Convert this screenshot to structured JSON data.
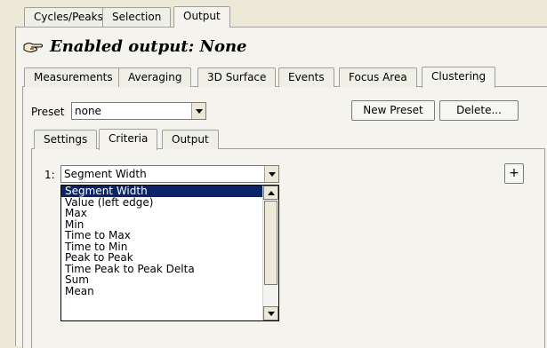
{
  "top_tabs": [
    "Cycles/Peaks",
    "Selection",
    "Output"
  ],
  "header": {
    "title": "Enabled output: None",
    "icon": "hand-pointer-icon"
  },
  "output_tabs": [
    "Measurements",
    "Averaging",
    "3D Surface",
    "Events",
    "Focus Area",
    "Clustering"
  ],
  "preset": {
    "label": "Preset",
    "value": "none",
    "new_button": "New Preset",
    "delete_button": "Delete..."
  },
  "inner_tabs": [
    "Settings",
    "Criteria",
    "Output"
  ],
  "criteria": {
    "index_label": "1:",
    "selected": "Segment Width",
    "add_button": "+",
    "options": [
      "Segment Width",
      "Value (left edge)",
      "Max",
      "Min",
      "Time to Max",
      "Time to Min",
      "Peak to Peak",
      "Time Peak to Peak Delta",
      "Sum",
      "Mean"
    ]
  },
  "colors": {
    "selection": "#0a246a",
    "panel": "#f4f3ee",
    "background": "#ece9d8"
  }
}
